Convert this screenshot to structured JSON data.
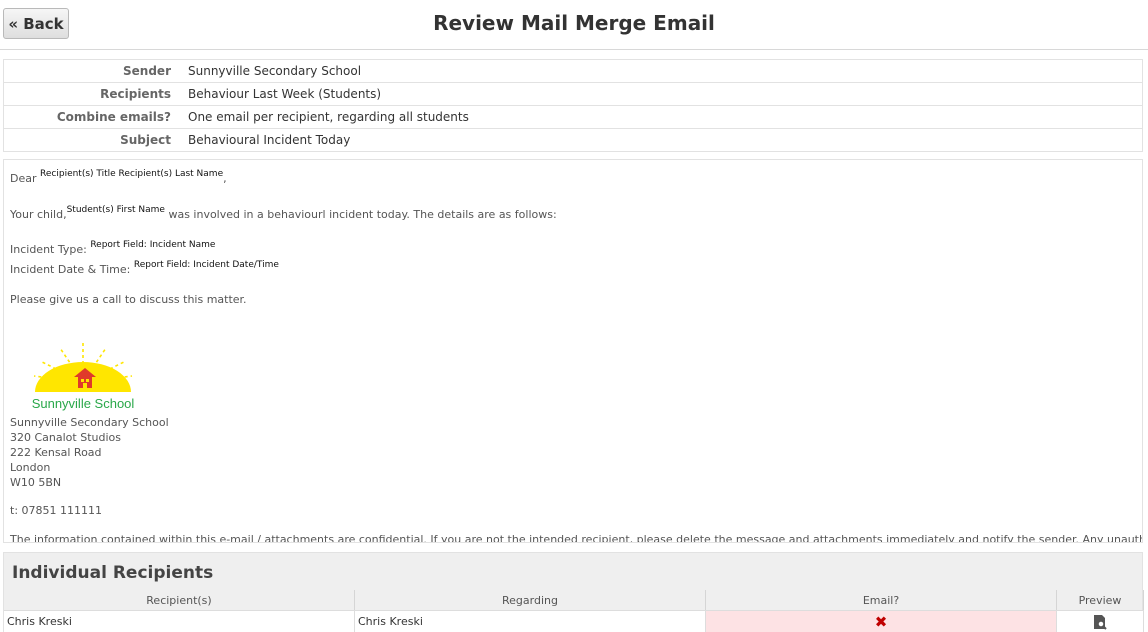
{
  "header": {
    "back_label": "« Back",
    "title": "Review Mail Merge Email"
  },
  "meta": [
    {
      "label": "Sender",
      "value": "Sunnyville Secondary School"
    },
    {
      "label": "Recipients",
      "value": "Behaviour Last Week (Students)"
    },
    {
      "label": "Combine emails?",
      "value": "One email per recipient, regarding all students"
    },
    {
      "label": "Subject",
      "value": "Behavioural Incident Today"
    }
  ],
  "email": {
    "greeting": "Dear",
    "greeting_field": "Recipient(s) Title Recipient(s) Last Name",
    "greeting_end": ",",
    "child_pre": "Your child,",
    "child_field": "Student(s) First Name",
    "child_post": "was involved in a behaviourl incident today. The details are as follows:",
    "incident_type_label": "Incident Type:",
    "incident_type_field": "Report Field: Incident Name",
    "incident_date_label": "Incident Date & Time:",
    "incident_date_field": "Report Field: Incident Date/Time",
    "call_text": "Please give us a call to discuss this matter.",
    "logo_text": "Sunnyville School",
    "address": [
      "Sunnyville Secondary School",
      "320 Canalot Studios",
      "222 Kensal Road",
      "London",
      "W10 5BN"
    ],
    "phone": "t: 07851 111111",
    "disclaimer": "The information contained within this e-mail / attachments are confidential. If you are not the intended recipient, please delete the message and attachments immediately and notify the sender. Any unauthorised dissemination or copying of this"
  },
  "recipients": {
    "title": "Individual Recipients",
    "columns": [
      "Recipient(s)",
      "Regarding",
      "Email?",
      "Preview"
    ],
    "rows": [
      {
        "recipient": "Chris Kreski",
        "regarding": "Chris Kreski"
      }
    ]
  },
  "colors": {
    "email_missing_bg": "#fde2e4",
    "error_red": "#c00000",
    "logo_green": "#2aa84a",
    "logo_yellow": "#ffe600"
  }
}
